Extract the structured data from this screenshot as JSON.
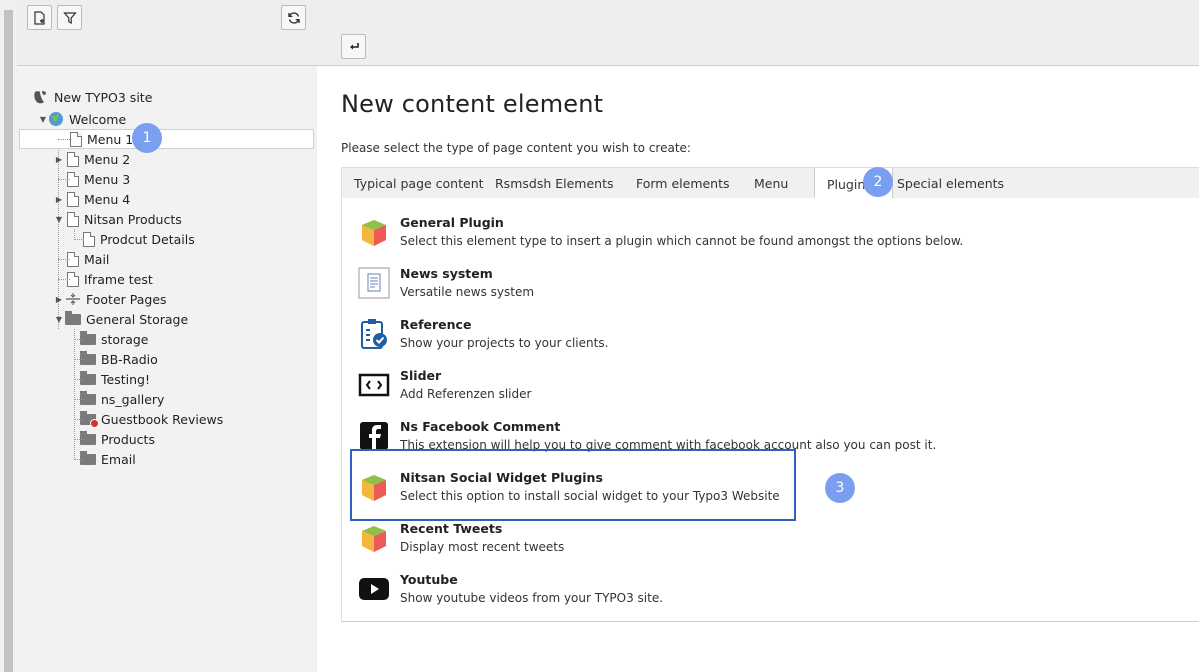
{
  "toolbar": {
    "new_page_icon": "new-page-icon",
    "filter_icon": "filter-icon",
    "refresh_icon": "refresh-icon",
    "return_icon": "return-icon"
  },
  "tree": {
    "root_label": "New TYPO3 site",
    "nodes": [
      {
        "label": "Welcome"
      },
      {
        "label": "Menu 1"
      },
      {
        "label": "Menu 2"
      },
      {
        "label": "Menu 3"
      },
      {
        "label": "Menu 4"
      },
      {
        "label": "Nitsan Products"
      },
      {
        "label": "Prodcut Details"
      },
      {
        "label": "Mail"
      },
      {
        "label": "Iframe test"
      },
      {
        "label": "Footer Pages"
      },
      {
        "label": "General Storage"
      },
      {
        "label": "storage"
      },
      {
        "label": "BB-Radio"
      },
      {
        "label": "Testing!"
      },
      {
        "label": "ns_gallery"
      },
      {
        "label": "Guestbook Reviews"
      },
      {
        "label": "Products"
      },
      {
        "label": "Email"
      }
    ]
  },
  "badges": [
    "1",
    "2",
    "3"
  ],
  "main": {
    "title": "New content element",
    "subtitle": "Please select the type of page content you wish to create:",
    "tabs": [
      {
        "label": "Typical page content"
      },
      {
        "label": "Rsmsdsh Elements"
      },
      {
        "label": "Form elements"
      },
      {
        "label": "Menu"
      },
      {
        "label": "Plugins",
        "active": true
      },
      {
        "label": "Special elements"
      }
    ],
    "items": [
      {
        "name": "General Plugin",
        "desc": "Select this element type to insert a plugin which cannot be found amongst the options below.",
        "icon": "plugin-cube-icon"
      },
      {
        "name": "News system",
        "desc": "Versatile news system",
        "icon": "news-icon"
      },
      {
        "name": "Reference",
        "desc": "Show your projects to your clients.",
        "icon": "reference-clipboard-icon"
      },
      {
        "name": "Slider",
        "desc": "Add Referenzen slider",
        "icon": "slider-icon"
      },
      {
        "name": "Ns Facebook Comment",
        "desc": "This extension will help you to give comment with facebook account also you can post it.",
        "icon": "facebook-icon"
      },
      {
        "name": "Nitsan Social Widget Plugins",
        "desc": "Select this option to install social widget to your Typo3 Website",
        "icon": "plugin-cube-icon"
      },
      {
        "name": "Recent Tweets",
        "desc": "Display most recent tweets",
        "icon": "plugin-cube-icon"
      },
      {
        "name": "Youtube",
        "desc": "Show youtube videos from your TYPO3 site.",
        "icon": "youtube-icon"
      }
    ]
  },
  "colors": {
    "badge": "#7b9ff0",
    "highlight_border": "#2f5fc4"
  }
}
